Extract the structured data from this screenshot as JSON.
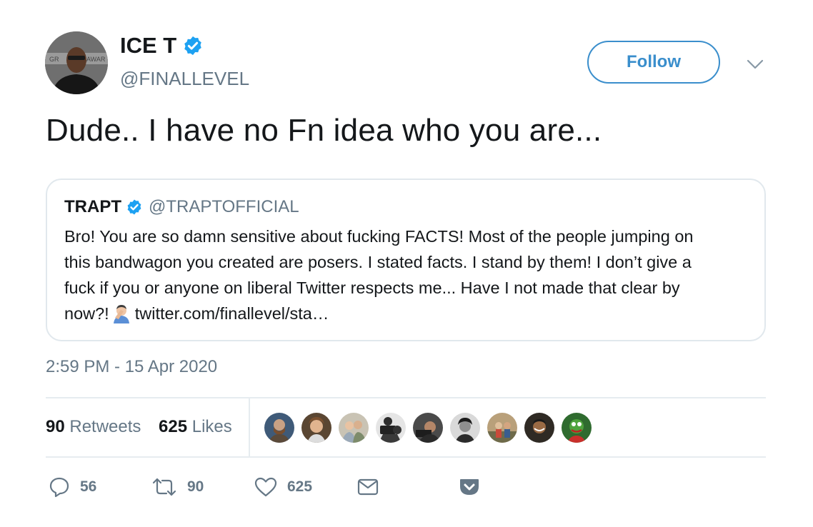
{
  "author": {
    "display_name": "ICE T",
    "handle": "@FINALLEVEL",
    "verified": true
  },
  "follow_button": {
    "label": "Follow"
  },
  "tweet": {
    "text": "Dude.. I have no Fn idea who you are...",
    "timestamp": "2:59 PM - 15 Apr 2020"
  },
  "quoted_tweet": {
    "display_name": "TRAPT",
    "handle": "@TRAPTOFFICIAL",
    "verified": true,
    "lines": [
      "Bro! You are so damn sensitive about fucking FACTS! Most of the people jumping on",
      "this bandwagon you created are posers. I stated facts. I stand by them! I don’t give a",
      "fuck if you or anyone on liberal Twitter respects me... Have I not made that clear by"
    ],
    "last_line_start": "now?!",
    "emoji": "man-facepalming-emoji",
    "link": "twitter.com/finallevel/sta…"
  },
  "stats": {
    "retweets_count": "90",
    "retweets_label": "Retweets",
    "likes_count": "625",
    "likes_label": "Likes",
    "liker_avatars": 9
  },
  "actions": {
    "reply_count": "56",
    "retweet_count": "90",
    "like_count": "625"
  },
  "colors": {
    "accent": "#3a8ecc",
    "verified": "#1da1f2",
    "secondary_text": "#657786",
    "border": "#e1e8ed"
  }
}
